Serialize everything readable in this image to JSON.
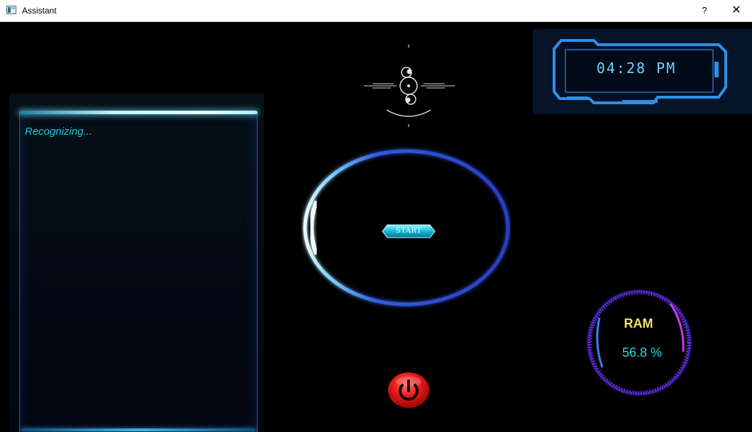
{
  "window": {
    "title": "Assistant",
    "help_label": "?",
    "close_label": "✕"
  },
  "recognizer": {
    "status_text": "Recognizing..."
  },
  "start_button": {
    "label": "START"
  },
  "clock": {
    "time_text": "04:28 PM"
  },
  "ram": {
    "label": "RAM",
    "value_text": "56.8 %",
    "percent": 56.8
  },
  "icons": {
    "app": "app-window-icon",
    "power": "power-icon",
    "hud": "crosshair-hud-icon"
  },
  "colors": {
    "recognizing_text": "#1ec8d8",
    "clock_text": "#6fd3ff",
    "ram_label": "#f4e06a",
    "ram_value": "#26d6e2",
    "power_red": "#e01818",
    "ring_blue": "#2a44c8"
  }
}
